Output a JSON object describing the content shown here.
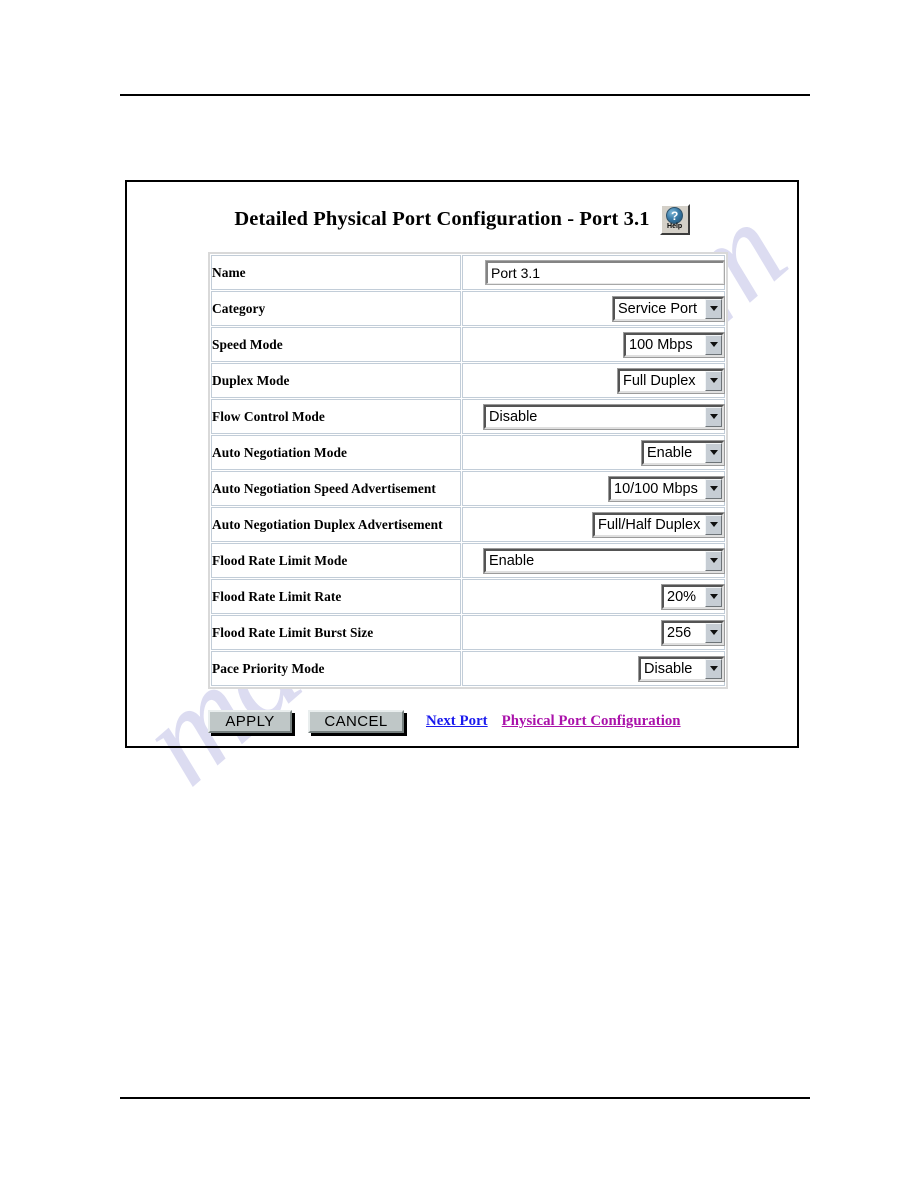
{
  "document": {
    "rules": {
      "top": true,
      "bottom": true
    }
  },
  "watermark": {
    "text": "manualslib.com"
  },
  "figure": {
    "title": "Detailed Physical Port Configuration - Port 3.1",
    "help": {
      "icon": "question-mark-icon",
      "label": "Help"
    },
    "table": {
      "rows": [
        {
          "label": "Name",
          "control": "text",
          "value": "Port 3.1"
        },
        {
          "label": "Category",
          "control": "select",
          "value": "Service Port"
        },
        {
          "label": "Speed Mode",
          "control": "select",
          "value": "100 Mbps"
        },
        {
          "label": "Duplex Mode",
          "control": "select",
          "value": "Full Duplex"
        },
        {
          "label": "Flow Control Mode",
          "control": "select",
          "value": "Disable"
        },
        {
          "label": "Auto Negotiation Mode",
          "control": "select",
          "value": "Enable"
        },
        {
          "label": "Auto Negotiation Speed Advertisement",
          "control": "select",
          "value": "10/100 Mbps"
        },
        {
          "label": "Auto Negotiation Duplex Advertisement",
          "control": "select",
          "value": "Full/Half Duplex"
        },
        {
          "label": "Flood Rate Limit Mode",
          "control": "select",
          "value": "Enable"
        },
        {
          "label": "Flood Rate Limit Rate",
          "control": "select",
          "value": "20%"
        },
        {
          "label": "Flood Rate Limit Burst Size",
          "control": "select",
          "value": "256"
        },
        {
          "label": "Pace Priority Mode",
          "control": "select",
          "value": "Disable"
        }
      ]
    },
    "footer": {
      "apply_label": "APPLY",
      "cancel_label": "CANCEL",
      "next_port_label": "Next Port",
      "physical_port_config_label": "Physical Port Configuration"
    }
  },
  "colors": {
    "link_next": "#1a1aee",
    "link_ppc": "#aa11aa",
    "button_face": "#bfc7c7",
    "watermark": "#c8c8ea"
  }
}
